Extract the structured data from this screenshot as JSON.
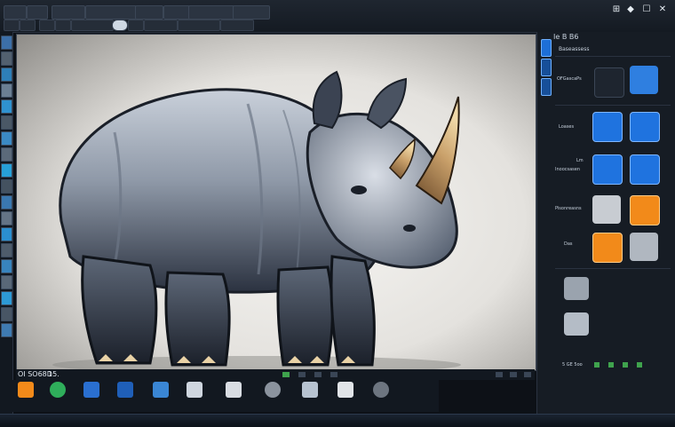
{
  "window": {
    "controls": [
      "⊞",
      "◆",
      "☐",
      "✕"
    ]
  },
  "canvas": {
    "status_label": "OI SO68D",
    "status_value": "15.",
    "image_description_icon": "rhino-render"
  },
  "right_panel": {
    "header": "Ie B B6",
    "section_title": "Baseassess",
    "rows": [
      {
        "label": "OFGascaPs"
      },
      {
        "label": "Loases"
      },
      {
        "label": "Lm"
      },
      {
        "label": "Inoocsasen"
      },
      {
        "label": "Pisonreasns"
      },
      {
        "label": "Das"
      }
    ],
    "footer_text": "5 GE 5oo"
  },
  "colors": {
    "accent": "#1d6fd8",
    "icon_orange": "#f28a1a",
    "canvas_bg": "#e9e8e5",
    "panel_bg": "#161c24"
  }
}
